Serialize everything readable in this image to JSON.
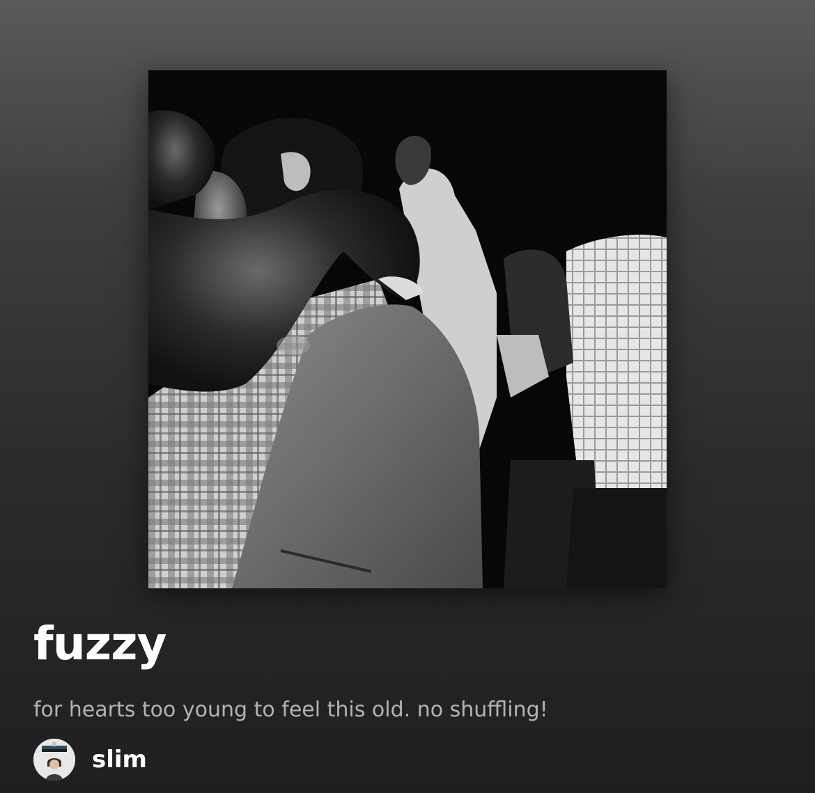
{
  "playlist": {
    "cover_icon": "playlist-cover-photo",
    "title": "fuzzy",
    "description": "for hearts too young to feel this old. no shuffling!"
  },
  "owner": {
    "avatar_icon": "user-avatar",
    "name": "slim"
  },
  "colors": {
    "background_top": "#5a5a5a",
    "background_bottom": "#1f1f1f",
    "title": "#ffffff",
    "description": "#b3b3b3"
  }
}
